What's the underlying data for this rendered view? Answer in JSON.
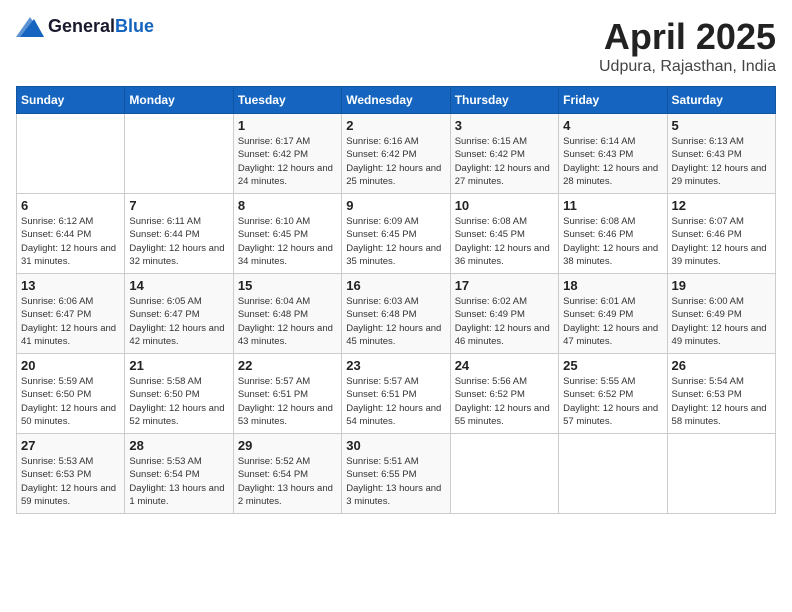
{
  "header": {
    "logo_general": "General",
    "logo_blue": "Blue",
    "title": "April 2025",
    "location": "Udpura, Rajasthan, India"
  },
  "days_of_week": [
    "Sunday",
    "Monday",
    "Tuesday",
    "Wednesday",
    "Thursday",
    "Friday",
    "Saturday"
  ],
  "weeks": [
    [
      {
        "day": "",
        "sunrise": "",
        "sunset": "",
        "daylight": ""
      },
      {
        "day": "",
        "sunrise": "",
        "sunset": "",
        "daylight": ""
      },
      {
        "day": "1",
        "sunrise": "Sunrise: 6:17 AM",
        "sunset": "Sunset: 6:42 PM",
        "daylight": "Daylight: 12 hours and 24 minutes."
      },
      {
        "day": "2",
        "sunrise": "Sunrise: 6:16 AM",
        "sunset": "Sunset: 6:42 PM",
        "daylight": "Daylight: 12 hours and 25 minutes."
      },
      {
        "day": "3",
        "sunrise": "Sunrise: 6:15 AM",
        "sunset": "Sunset: 6:42 PM",
        "daylight": "Daylight: 12 hours and 27 minutes."
      },
      {
        "day": "4",
        "sunrise": "Sunrise: 6:14 AM",
        "sunset": "Sunset: 6:43 PM",
        "daylight": "Daylight: 12 hours and 28 minutes."
      },
      {
        "day": "5",
        "sunrise": "Sunrise: 6:13 AM",
        "sunset": "Sunset: 6:43 PM",
        "daylight": "Daylight: 12 hours and 29 minutes."
      }
    ],
    [
      {
        "day": "6",
        "sunrise": "Sunrise: 6:12 AM",
        "sunset": "Sunset: 6:44 PM",
        "daylight": "Daylight: 12 hours and 31 minutes."
      },
      {
        "day": "7",
        "sunrise": "Sunrise: 6:11 AM",
        "sunset": "Sunset: 6:44 PM",
        "daylight": "Daylight: 12 hours and 32 minutes."
      },
      {
        "day": "8",
        "sunrise": "Sunrise: 6:10 AM",
        "sunset": "Sunset: 6:45 PM",
        "daylight": "Daylight: 12 hours and 34 minutes."
      },
      {
        "day": "9",
        "sunrise": "Sunrise: 6:09 AM",
        "sunset": "Sunset: 6:45 PM",
        "daylight": "Daylight: 12 hours and 35 minutes."
      },
      {
        "day": "10",
        "sunrise": "Sunrise: 6:08 AM",
        "sunset": "Sunset: 6:45 PM",
        "daylight": "Daylight: 12 hours and 36 minutes."
      },
      {
        "day": "11",
        "sunrise": "Sunrise: 6:08 AM",
        "sunset": "Sunset: 6:46 PM",
        "daylight": "Daylight: 12 hours and 38 minutes."
      },
      {
        "day": "12",
        "sunrise": "Sunrise: 6:07 AM",
        "sunset": "Sunset: 6:46 PM",
        "daylight": "Daylight: 12 hours and 39 minutes."
      }
    ],
    [
      {
        "day": "13",
        "sunrise": "Sunrise: 6:06 AM",
        "sunset": "Sunset: 6:47 PM",
        "daylight": "Daylight: 12 hours and 41 minutes."
      },
      {
        "day": "14",
        "sunrise": "Sunrise: 6:05 AM",
        "sunset": "Sunset: 6:47 PM",
        "daylight": "Daylight: 12 hours and 42 minutes."
      },
      {
        "day": "15",
        "sunrise": "Sunrise: 6:04 AM",
        "sunset": "Sunset: 6:48 PM",
        "daylight": "Daylight: 12 hours and 43 minutes."
      },
      {
        "day": "16",
        "sunrise": "Sunrise: 6:03 AM",
        "sunset": "Sunset: 6:48 PM",
        "daylight": "Daylight: 12 hours and 45 minutes."
      },
      {
        "day": "17",
        "sunrise": "Sunrise: 6:02 AM",
        "sunset": "Sunset: 6:49 PM",
        "daylight": "Daylight: 12 hours and 46 minutes."
      },
      {
        "day": "18",
        "sunrise": "Sunrise: 6:01 AM",
        "sunset": "Sunset: 6:49 PM",
        "daylight": "Daylight: 12 hours and 47 minutes."
      },
      {
        "day": "19",
        "sunrise": "Sunrise: 6:00 AM",
        "sunset": "Sunset: 6:49 PM",
        "daylight": "Daylight: 12 hours and 49 minutes."
      }
    ],
    [
      {
        "day": "20",
        "sunrise": "Sunrise: 5:59 AM",
        "sunset": "Sunset: 6:50 PM",
        "daylight": "Daylight: 12 hours and 50 minutes."
      },
      {
        "day": "21",
        "sunrise": "Sunrise: 5:58 AM",
        "sunset": "Sunset: 6:50 PM",
        "daylight": "Daylight: 12 hours and 52 minutes."
      },
      {
        "day": "22",
        "sunrise": "Sunrise: 5:57 AM",
        "sunset": "Sunset: 6:51 PM",
        "daylight": "Daylight: 12 hours and 53 minutes."
      },
      {
        "day": "23",
        "sunrise": "Sunrise: 5:57 AM",
        "sunset": "Sunset: 6:51 PM",
        "daylight": "Daylight: 12 hours and 54 minutes."
      },
      {
        "day": "24",
        "sunrise": "Sunrise: 5:56 AM",
        "sunset": "Sunset: 6:52 PM",
        "daylight": "Daylight: 12 hours and 55 minutes."
      },
      {
        "day": "25",
        "sunrise": "Sunrise: 5:55 AM",
        "sunset": "Sunset: 6:52 PM",
        "daylight": "Daylight: 12 hours and 57 minutes."
      },
      {
        "day": "26",
        "sunrise": "Sunrise: 5:54 AM",
        "sunset": "Sunset: 6:53 PM",
        "daylight": "Daylight: 12 hours and 58 minutes."
      }
    ],
    [
      {
        "day": "27",
        "sunrise": "Sunrise: 5:53 AM",
        "sunset": "Sunset: 6:53 PM",
        "daylight": "Daylight: 12 hours and 59 minutes."
      },
      {
        "day": "28",
        "sunrise": "Sunrise: 5:53 AM",
        "sunset": "Sunset: 6:54 PM",
        "daylight": "Daylight: 13 hours and 1 minute."
      },
      {
        "day": "29",
        "sunrise": "Sunrise: 5:52 AM",
        "sunset": "Sunset: 6:54 PM",
        "daylight": "Daylight: 13 hours and 2 minutes."
      },
      {
        "day": "30",
        "sunrise": "Sunrise: 5:51 AM",
        "sunset": "Sunset: 6:55 PM",
        "daylight": "Daylight: 13 hours and 3 minutes."
      },
      {
        "day": "",
        "sunrise": "",
        "sunset": "",
        "daylight": ""
      },
      {
        "day": "",
        "sunrise": "",
        "sunset": "",
        "daylight": ""
      },
      {
        "day": "",
        "sunrise": "",
        "sunset": "",
        "daylight": ""
      }
    ]
  ]
}
